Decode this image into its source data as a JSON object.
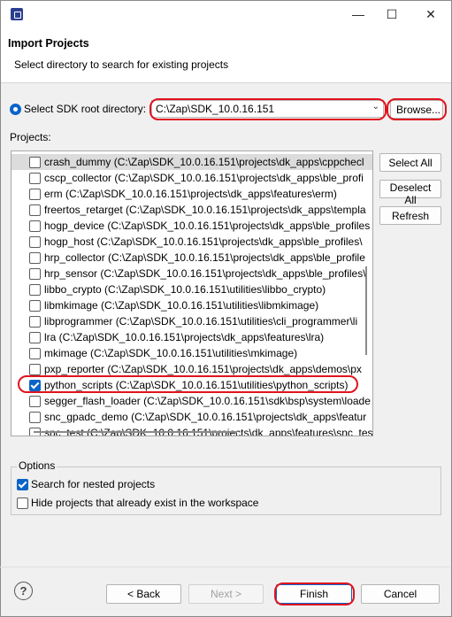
{
  "window": {
    "minimize_glyph": "—",
    "maximize_glyph": "☐",
    "close_glyph": "✕"
  },
  "header": {
    "title": "Import Projects",
    "subtitle": "Select directory to search for existing projects"
  },
  "sdk": {
    "label": "Select SDK root directory:",
    "value": "C:\\Zap\\SDK_10.0.16.151",
    "browse_label": "Browse..."
  },
  "projects": {
    "label": "Projects:",
    "items": [
      {
        "label": "crash_dummy (C:\\Zap\\SDK_10.0.16.151\\projects\\dk_apps\\cppchecl",
        "checked": false
      },
      {
        "label": "cscp_collector (C:\\Zap\\SDK_10.0.16.151\\projects\\dk_apps\\ble_profi",
        "checked": false
      },
      {
        "label": "erm (C:\\Zap\\SDK_10.0.16.151\\projects\\dk_apps\\features\\erm)",
        "checked": false
      },
      {
        "label": "freertos_retarget (C:\\Zap\\SDK_10.0.16.151\\projects\\dk_apps\\templa",
        "checked": false
      },
      {
        "label": "hogp_device (C:\\Zap\\SDK_10.0.16.151\\projects\\dk_apps\\ble_profiles",
        "checked": false
      },
      {
        "label": "hogp_host (C:\\Zap\\SDK_10.0.16.151\\projects\\dk_apps\\ble_profiles\\",
        "checked": false
      },
      {
        "label": "hrp_collector (C:\\Zap\\SDK_10.0.16.151\\projects\\dk_apps\\ble_profile",
        "checked": false
      },
      {
        "label": "hrp_sensor (C:\\Zap\\SDK_10.0.16.151\\projects\\dk_apps\\ble_profiles\\",
        "checked": false
      },
      {
        "label": "libbo_crypto (C:\\Zap\\SDK_10.0.16.151\\utilities\\libbo_crypto)",
        "checked": false
      },
      {
        "label": "libmkimage (C:\\Zap\\SDK_10.0.16.151\\utilities\\libmkimage)",
        "checked": false
      },
      {
        "label": "libprogrammer (C:\\Zap\\SDK_10.0.16.151\\utilities\\cli_programmer\\li",
        "checked": false
      },
      {
        "label": "lra (C:\\Zap\\SDK_10.0.16.151\\projects\\dk_apps\\features\\lra)",
        "checked": false
      },
      {
        "label": "mkimage (C:\\Zap\\SDK_10.0.16.151\\utilities\\mkimage)",
        "checked": false
      },
      {
        "label": "pxp_reporter (C:\\Zap\\SDK_10.0.16.151\\projects\\dk_apps\\demos\\px",
        "checked": false
      },
      {
        "label": "python_scripts (C:\\Zap\\SDK_10.0.16.151\\utilities\\python_scripts)",
        "checked": true
      },
      {
        "label": "segger_flash_loader (C:\\Zap\\SDK_10.0.16.151\\sdk\\bsp\\system\\loade",
        "checked": false
      },
      {
        "label": "snc_gpadc_demo (C:\\Zap\\SDK_10.0.16.151\\projects\\dk_apps\\featur",
        "checked": false
      },
      {
        "label": "snc_test (C:\\Zap\\SDK_10.0.16.151\\projects\\dk_apps\\features\\snc_tes",
        "checked": false
      }
    ],
    "select_all": "Select All",
    "deselect_all": "Deselect All",
    "refresh": "Refresh"
  },
  "options": {
    "label": "Options",
    "search_nested": {
      "label": "Search for nested projects",
      "checked": true
    },
    "hide_existing": {
      "label": "Hide projects that already exist in the workspace",
      "checked": false
    }
  },
  "footer": {
    "help": "?",
    "back": "< Back",
    "next": "Next >",
    "finish": "Finish",
    "cancel": "Cancel"
  }
}
